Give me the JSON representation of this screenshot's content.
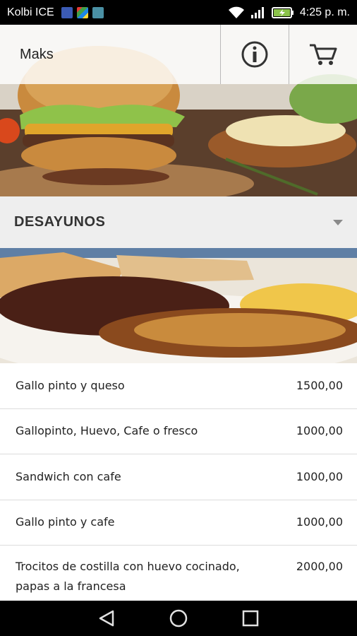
{
  "status_bar": {
    "carrier": "Kolbi ICE",
    "time": "4:25 p. m."
  },
  "app_bar": {
    "title": "Maks",
    "icons": [
      "info-icon",
      "cart-icon"
    ]
  },
  "category": {
    "label": "DESAYUNOS",
    "icon": "dropdown-arrow-icon"
  },
  "menu": {
    "items": [
      {
        "name": "Gallo pinto y queso",
        "price": "1500,00"
      },
      {
        "name": "Gallopinto, Huevo, Cafe o fresco",
        "price": "1000,00"
      },
      {
        "name": "Sandwich con cafe",
        "price": "1000,00"
      },
      {
        "name": "Gallo pinto y cafe",
        "price": "1000,00"
      },
      {
        "name": "Trocitos de costilla con huevo cocinado, papas a la francesa",
        "price": "2000,00"
      }
    ]
  },
  "nav_bar": {
    "icons": [
      "back-icon",
      "home-icon",
      "recents-icon"
    ]
  },
  "colors": {
    "status_bar_bg": "#000000",
    "category_bg": "#eeeeee",
    "divider": "#dcdcdc"
  }
}
